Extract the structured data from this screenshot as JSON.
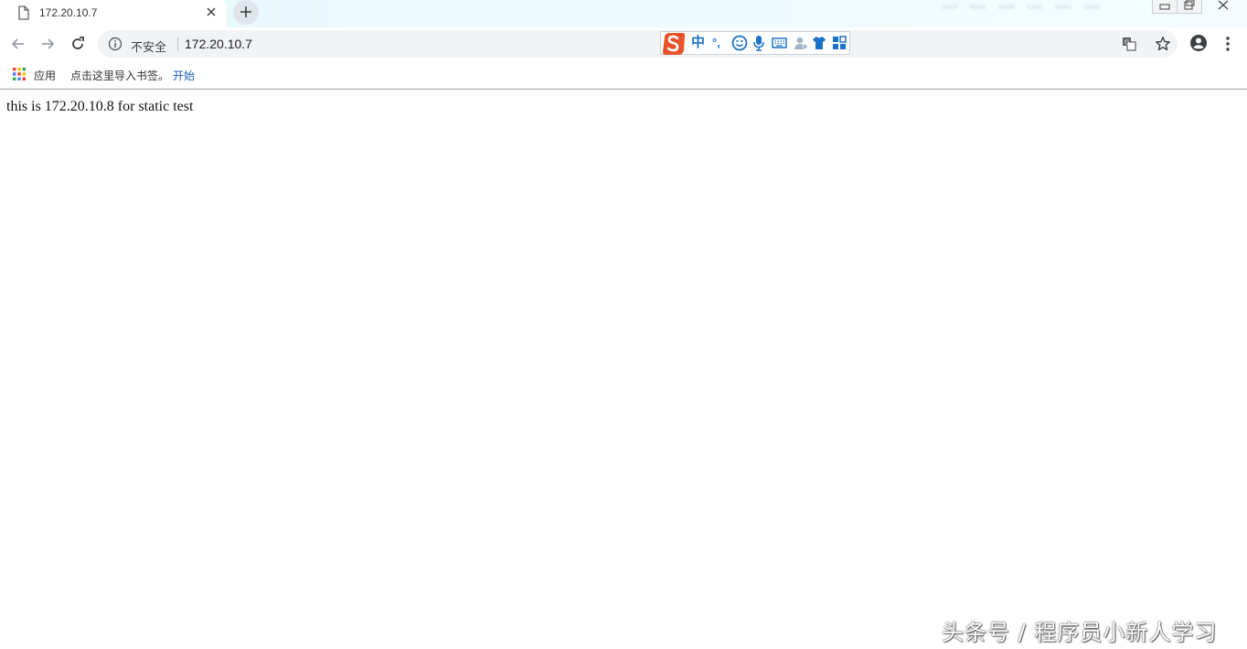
{
  "tab": {
    "title": "172.20.10.7"
  },
  "omnibox": {
    "security_label": "不安全",
    "url": "172.20.10.7"
  },
  "ime": {
    "lang": "中",
    "punct": "°,"
  },
  "bookmarks": {
    "apps_label": "应用",
    "import_text": "点击这里导入书签。",
    "start_link": "开始"
  },
  "page": {
    "body_text": "this is 172.20.10.8 for static test"
  },
  "watermark": {
    "text": "头条号 / 程序员小新人学习"
  },
  "colors": {
    "accent": "#1a73e8",
    "ime_blue": "#1b72c9",
    "sogou_orange": "#e8532b",
    "tabstrip": "#e6f8fc"
  }
}
